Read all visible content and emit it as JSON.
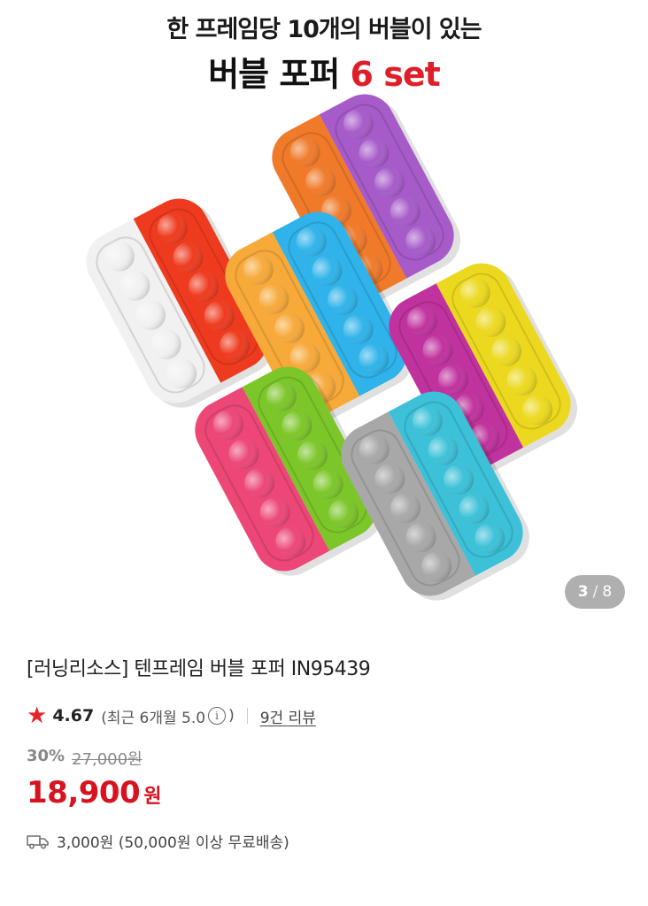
{
  "hero": {
    "headline_line1": "한 프레임당 10개의 버블이 있는",
    "headline_line2_main": "버블 포퍼",
    "headline_line2_accent": "6 set",
    "accent_color": "#e01e2a"
  },
  "gallery": {
    "current": "3",
    "separator": "/",
    "total": "8"
  },
  "product": {
    "title": "[러닝리소스] 텐프레임 버블 포퍼 IN95439",
    "rating": {
      "star_icon": "star-icon",
      "score": "4.67",
      "recent_prefix": "(최근 6개월 5.0",
      "info_icon": "ⓘ",
      "recent_suffix": ")",
      "reviews": "9건 리뷰"
    },
    "price": {
      "discount_rate": "30%",
      "original": "27,000원",
      "sale": "18,900",
      "sale_unit": "원",
      "sale_color": "#d8121f"
    },
    "shipping": {
      "icon": "truck-icon",
      "text": "3,000원 (50,000원 이상 무료배송)"
    }
  }
}
